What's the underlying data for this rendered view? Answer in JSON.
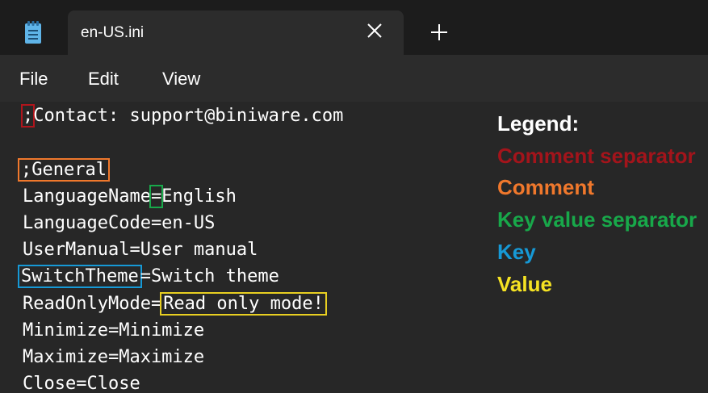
{
  "tab": {
    "title": "en-US.ini",
    "icon": "notepad-icon"
  },
  "menu": {
    "file": "File",
    "edit": "Edit",
    "view": "View"
  },
  "editor": {
    "line1_sep": ";",
    "line1_rest": "Contact: support@biniware.com",
    "line2": ";General",
    "line3_key": "LanguageName",
    "line3_sep": "=",
    "line3_value": "English",
    "line4": "LanguageCode=en-US",
    "line5": "UserManual=User manual",
    "line6_key": "SwitchTheme",
    "line6_rest": "=Switch theme",
    "line7_key": "ReadOnlyMode=",
    "line7_value": "Read only mode!",
    "line8": "Minimize=Minimize",
    "line9": "Maximize=Maximize",
    "line10": "Close=Close"
  },
  "legend": {
    "title": "Legend:",
    "items": [
      {
        "label": "Comment separator",
        "color": "#a3141b"
      },
      {
        "label": "Comment",
        "color": "#f0782c"
      },
      {
        "label": "Key value separator",
        "color": "#18a84a"
      },
      {
        "label": "Key",
        "color": "#1699d6"
      },
      {
        "label": "Value",
        "color": "#f5e223"
      }
    ]
  },
  "colors": {
    "comment_separator_box": "#b0151c",
    "comment_box": "#f0782c",
    "separator_box": "#18a84a",
    "key_box": "#1699d6",
    "value_box": "#e8cf21"
  }
}
